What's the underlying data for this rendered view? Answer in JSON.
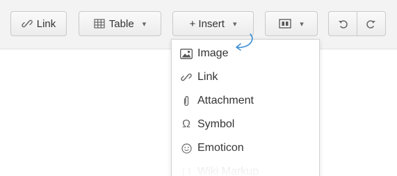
{
  "toolbar": {
    "link_label": "Link",
    "table_label": "Table",
    "insert_label": "+ Insert"
  },
  "insert_menu": {
    "items": [
      {
        "label": "Image",
        "icon": "image-icon"
      },
      {
        "label": "Link",
        "icon": "link-icon"
      },
      {
        "label": "Attachment",
        "icon": "paperclip-icon"
      },
      {
        "label": "Symbol",
        "icon": "omega-icon"
      },
      {
        "label": "Emoticon",
        "icon": "smiley-icon"
      },
      {
        "label": "Wiki Markup",
        "icon": "wiki-markup-icon"
      }
    ]
  },
  "colors": {
    "toolbar_bg": "#f3f3f3",
    "annotation_arrow": "#3d8fd6"
  }
}
